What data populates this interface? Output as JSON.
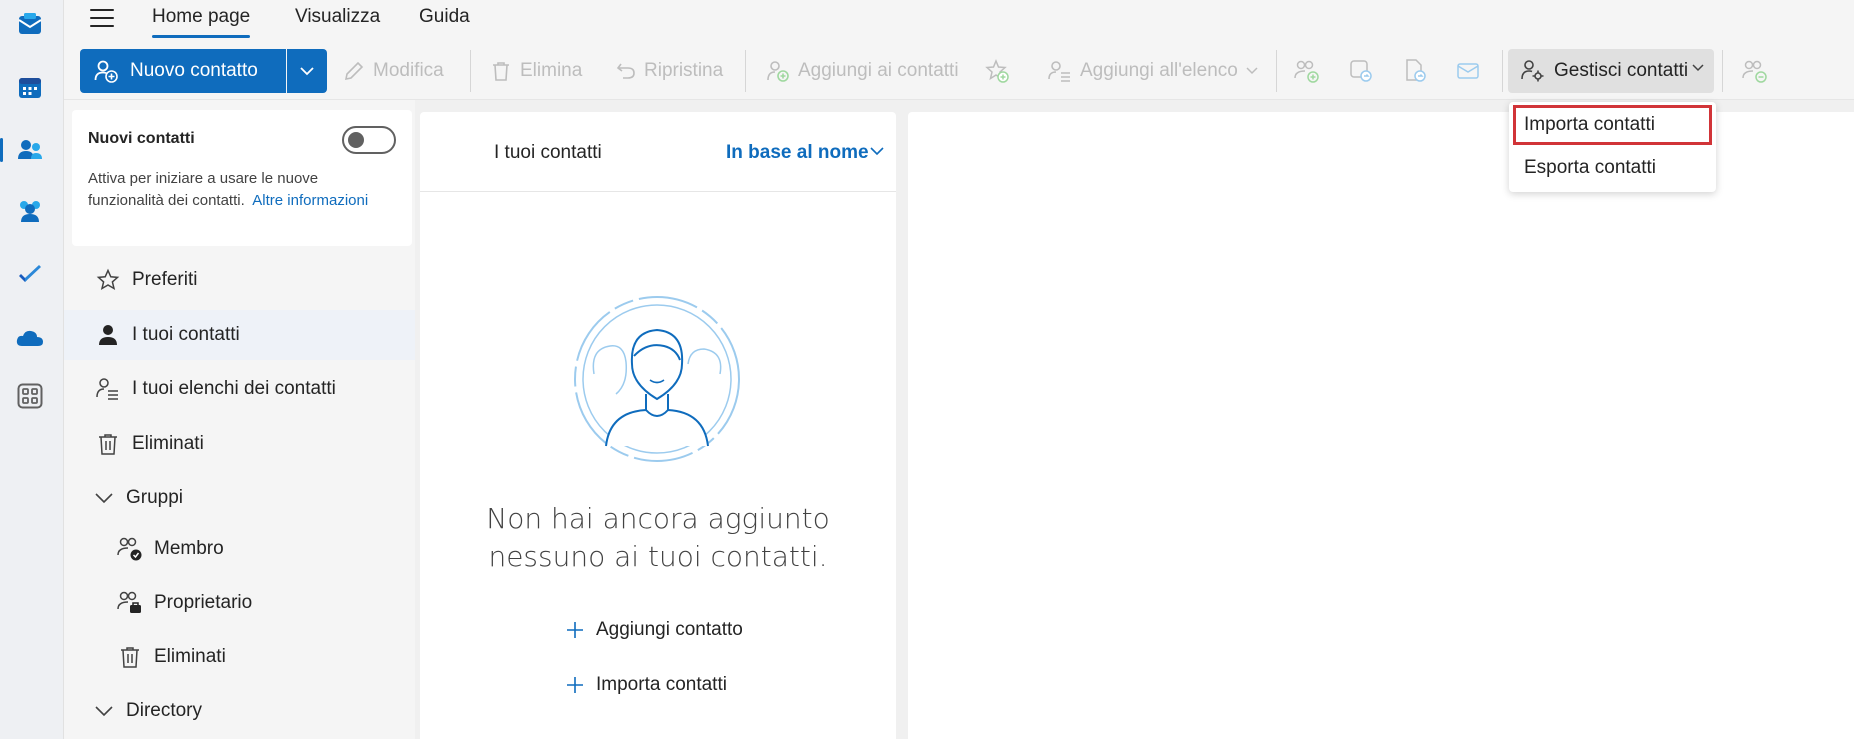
{
  "menubar": {
    "tabs": [
      {
        "label": "Home page",
        "active": true
      },
      {
        "label": "Visualizza",
        "active": false
      },
      {
        "label": "Guida",
        "active": false
      }
    ]
  },
  "toolbar": {
    "new_contact": "Nuovo contatto",
    "edit": "Modifica",
    "delete": "Elimina",
    "restore": "Ripristina",
    "add_to_contacts": "Aggiungi ai contatti",
    "add_to_list": "Aggiungi all'elenco",
    "manage_contacts": "Gestisci contatti"
  },
  "dropdown": {
    "items": [
      {
        "label": "Importa contatti",
        "highlighted": true
      },
      {
        "label": "Esporta contatti",
        "highlighted": false
      }
    ]
  },
  "promo": {
    "title": "Nuovi contatti",
    "text": "Attiva per iniziare a usare le nuove funzionalità dei contatti.",
    "link": "Altre informazioni",
    "toggle_on": false
  },
  "nav": {
    "favorites": "Preferiti",
    "your_contacts": "I tuoi contatti",
    "contact_lists": "I tuoi elenchi dei contatti",
    "deleted": "Eliminati",
    "groups": "Gruppi",
    "member": "Membro",
    "owner": "Proprietario",
    "groups_deleted": "Eliminati",
    "directory": "Directory"
  },
  "list": {
    "title": "I tuoi contatti",
    "sort": "In base al nome",
    "empty_message": "Non hai ancora aggiunto nessuno ai tuoi contatti.",
    "add_contact": "Aggiungi contatto",
    "import_contacts": "Importa contatti"
  },
  "colors": {
    "accent": "#0f6cbd",
    "highlight_border": "#d13438"
  }
}
